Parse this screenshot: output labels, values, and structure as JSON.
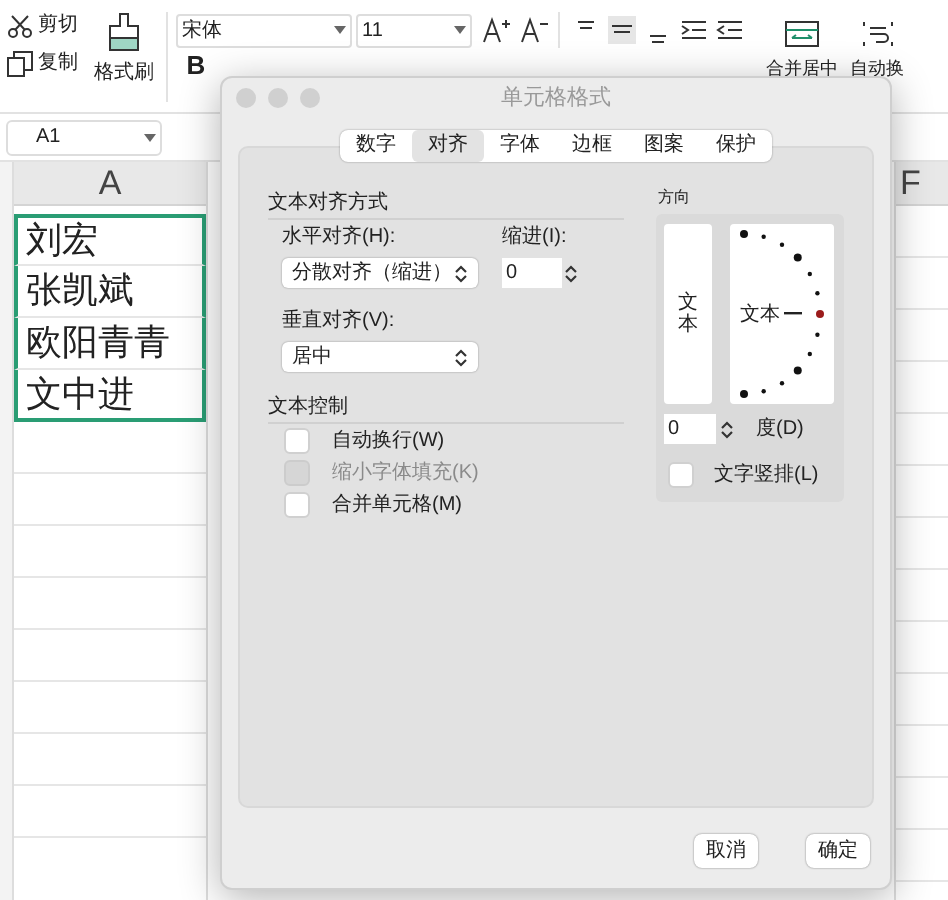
{
  "toolbar": {
    "clipboard": [
      {
        "kind": "cut",
        "label": "剪切"
      },
      {
        "kind": "copy",
        "label": "复制"
      }
    ],
    "format_painter": "格式刷",
    "font": "宋体",
    "size": "11",
    "bold": "B",
    "merge": "合并居中",
    "wrap": "自动换"
  },
  "name_box": "A1",
  "columns": [
    "A",
    "F"
  ],
  "cells": [
    {
      "text": "刘宏",
      "selected": true
    },
    {
      "text": "张凯斌",
      "selected": true
    },
    {
      "text": "欧阳青青",
      "selected": true
    },
    {
      "text": "文中进",
      "selected": true
    }
  ],
  "dialog": {
    "title": "单元格格式",
    "tabs": [
      {
        "label": "数字",
        "selected": false
      },
      {
        "label": "对齐",
        "selected": true
      },
      {
        "label": "字体",
        "selected": false
      },
      {
        "label": "边框",
        "selected": false
      },
      {
        "label": "图案",
        "selected": false
      },
      {
        "label": "保护",
        "selected": false
      }
    ],
    "alignment_section": "文本对齐方式",
    "horizontal_label": "水平对齐(H):",
    "horizontal_value": "分散对齐（缩进）",
    "indent_label": "缩进(I):",
    "indent_value": "0",
    "vertical_label": "垂直对齐(V):",
    "vertical_value": "居中",
    "control_section": "文本控制",
    "options": [
      {
        "label": "自动换行(W)",
        "checked": false,
        "disabled": false
      },
      {
        "label": "缩小字体填充(K)",
        "checked": false,
        "disabled": true
      },
      {
        "label": "合并单元格(M)",
        "checked": false,
        "disabled": false
      }
    ],
    "orientation_section": "方向",
    "vertical_text": "文本",
    "orientation_text": "文本",
    "degrees_value": "0",
    "degrees_label": "度(D)",
    "stacked": {
      "label": "文字竖排(L)",
      "checked": false
    },
    "buttons": [
      "取消",
      "确定"
    ]
  }
}
